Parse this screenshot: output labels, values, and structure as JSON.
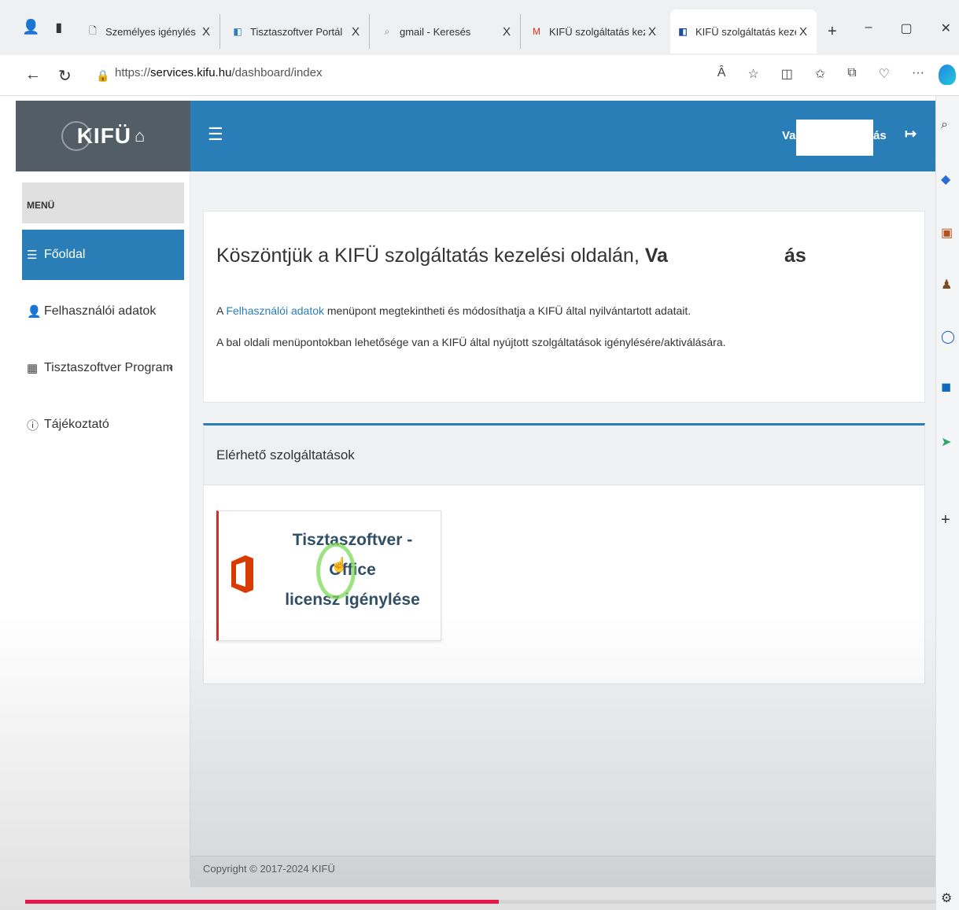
{
  "browser": {
    "tabs": [
      {
        "title": "Személyes igénylés - Tiszta",
        "close": "X"
      },
      {
        "title": "Tisztaszoftver Portál",
        "close": "X"
      },
      {
        "title": "gmail - Keresés",
        "close": "X"
      },
      {
        "title": "KIFÜ szolgáltatás kezelési o",
        "close": "X"
      },
      {
        "title": "KIFÜ szolgáltatás kezelési ol",
        "close": "X"
      }
    ],
    "new_tab": "+",
    "url_scheme": "https://",
    "url_host": "services.kifu.hu",
    "url_path": "/dashboard/index",
    "read_aloud": "Ȃ",
    "more": "···"
  },
  "header": {
    "logo_text": "KIFÜ",
    "menu_toggle": "☰",
    "user_prefix": "Va",
    "user_suffix": "ás",
    "logout_glyph": "↦"
  },
  "sidebar": {
    "heading": "MENÜ",
    "items": [
      {
        "label": "Főoldal",
        "icon": "list-icon"
      },
      {
        "label": "Felhasználói adatok",
        "icon": "user-icon"
      },
      {
        "label": "Tisztaszoftver Program",
        "icon": "windows-icon",
        "chevron": "‹"
      },
      {
        "label": "Tájékoztató",
        "icon": "info-icon"
      }
    ]
  },
  "welcome": {
    "title_prefix": "Köszöntjük a KIFÜ szolgáltatás kezelési oldalán, ",
    "name_prefix": "Va",
    "name_suffix": "ás",
    "line1_prefix": "A ",
    "line1_link": "Felhasználói adatok",
    "line1_suffix": " menüpont megtekintheti és módosíthatja a KIFÜ által nyilvántartott adatait.",
    "line2": "A bal oldali menüpontokban lehetősége van a KIFÜ által nyújtott szolgáltatások igénylésére/aktiválására."
  },
  "services": {
    "title": "Elérhető szolgáltatások",
    "cards": [
      {
        "title_line1": "Tisztaszoftver - Office",
        "title_line2": "licensz igénylése",
        "icon": "office-icon"
      }
    ]
  },
  "footer": {
    "text": "Copyright © 2017-2024 KIFÜ"
  },
  "video": {
    "progress": 0.52
  },
  "colors": {
    "primary": "#2a7eb8",
    "logo_bg": "#535d66",
    "office_red": "#d83b01",
    "card_accent": "#c9302c",
    "progress": "#e8174d"
  }
}
